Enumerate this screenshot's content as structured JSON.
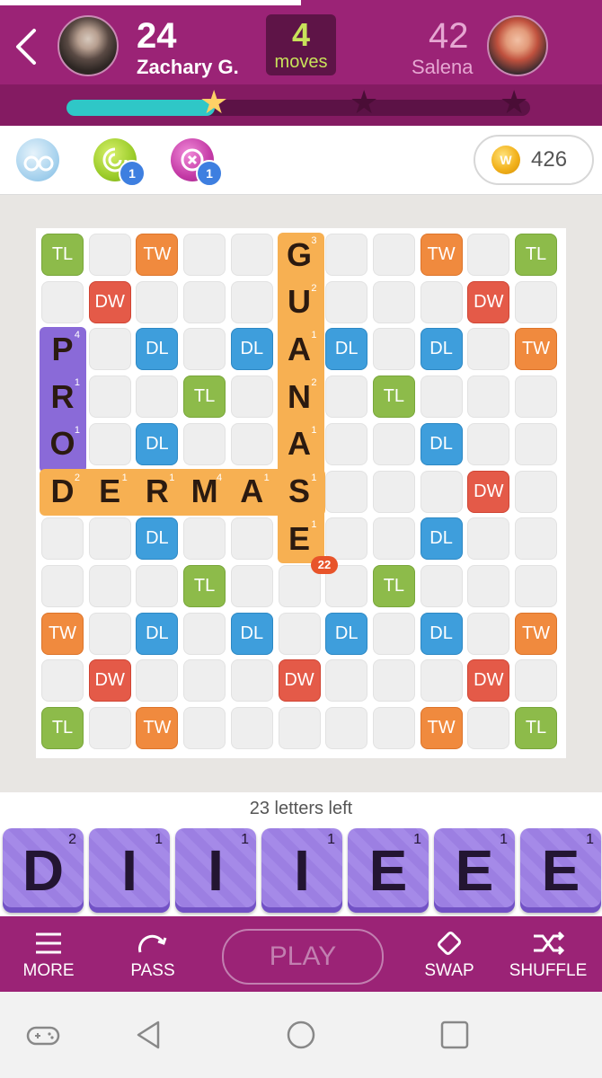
{
  "header": {
    "player": {
      "score": "24",
      "name": "Zachary G."
    },
    "opponent": {
      "score": "42",
      "name": "Salena"
    },
    "moves": {
      "count": "4",
      "label": "moves"
    },
    "progress": 0.32
  },
  "powerups": [
    {
      "name": "swap-powerup",
      "badge": ""
    },
    {
      "name": "radar-powerup",
      "badge": "1"
    },
    {
      "name": "hindsight-powerup",
      "badge": "1"
    }
  ],
  "coins": {
    "icon": "W",
    "value": "426"
  },
  "board": {
    "bonus_labels": {
      "TW": "TW",
      "DW": "DW",
      "TL": "TL",
      "DL": "DL"
    },
    "last_play_score": "22"
  },
  "letters_left": "23 letters left",
  "rack": [
    {
      "letter": "D",
      "points": "2"
    },
    {
      "letter": "I",
      "points": "1"
    },
    {
      "letter": "I",
      "points": "1"
    },
    {
      "letter": "I",
      "points": "1"
    },
    {
      "letter": "E",
      "points": "1"
    },
    {
      "letter": "E",
      "points": "1"
    },
    {
      "letter": "E",
      "points": "1"
    }
  ],
  "actions": {
    "more": "MORE",
    "pass": "PASS",
    "play": "PLAY",
    "swap": "SWAP",
    "shuffle": "SHUFFLE"
  },
  "colors": {
    "header": "#9b2376",
    "tw": "#f08a3e",
    "dw": "#e45a48",
    "tl": "#8dbb4a",
    "dl": "#3e9edc",
    "rack_tile": "#a58ae8"
  }
}
